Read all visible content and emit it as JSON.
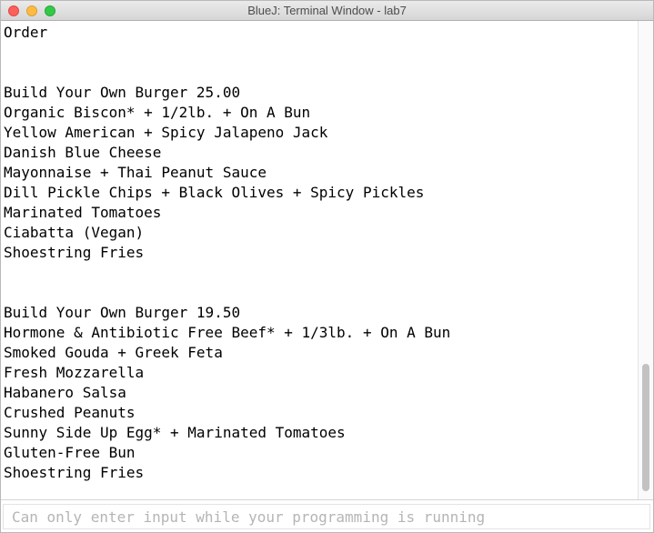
{
  "window": {
    "title": "BlueJ: Terminal Window - lab7",
    "close_glyph": "×",
    "minimize_glyph": "–",
    "maximize_glyph": "+"
  },
  "terminal": {
    "lines": [
      "Order",
      "",
      "",
      "Build Your Own Burger 25.00",
      "Organic Biscon* + 1/2lb. + On A Bun",
      "Yellow American + Spicy Jalapeno Jack",
      "Danish Blue Cheese",
      "Mayonnaise + Thai Peanut Sauce",
      "Dill Pickle Chips + Black Olives + Spicy Pickles",
      "Marinated Tomatoes",
      "Ciabatta (Vegan)",
      "Shoestring Fries",
      "",
      "",
      "Build Your Own Burger 19.50",
      "Hormone & Antibiotic Free Beef* + 1/3lb. + On A Bun",
      "Smoked Gouda + Greek Feta",
      "Fresh Mozzarella",
      "Habanero Salsa",
      "Crushed Peanuts",
      "Sunny Side Up Egg* + Marinated Tomatoes",
      "Gluten-Free Bun",
      "Shoestring Fries"
    ]
  },
  "input": {
    "value": "",
    "placeholder": "Can only enter input while your programming is running"
  },
  "icons": {
    "close": "close-icon",
    "minimize": "minimize-icon",
    "maximize": "maximize-icon"
  },
  "colors": {
    "close": "#fc605b",
    "minimize": "#fdbc40",
    "maximize": "#34c84a"
  }
}
